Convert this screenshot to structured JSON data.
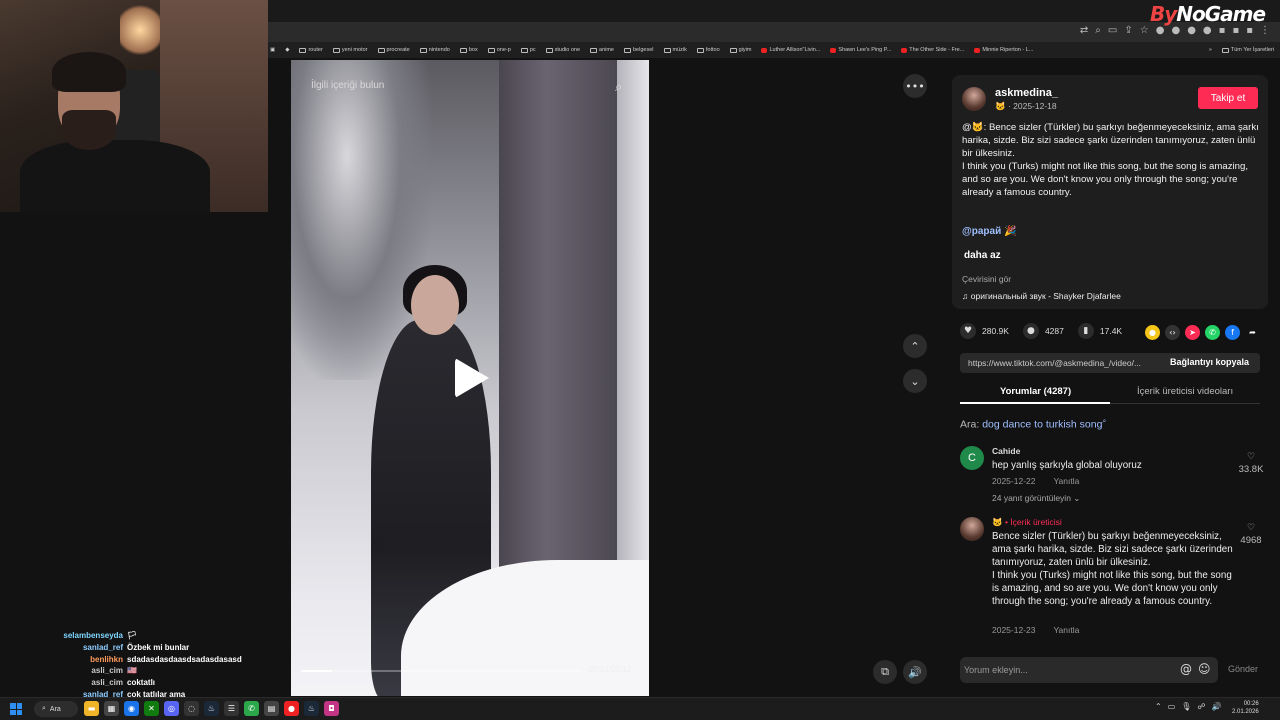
{
  "overlay": {
    "logo_prefix": "By",
    "logo_rest": "NoGame"
  },
  "chat": [
    {
      "user": "selambenseyda",
      "msg": "🏳",
      "user_color": "#7fd6ff"
    },
    {
      "user": "sanlad_ref",
      "msg": "Özbek mi bunlar",
      "user_color": "#8ecdff"
    },
    {
      "user": "benlihkn",
      "msg": "sdadasdasdaasdsadasdasasd",
      "user_color": "#ff9a5c"
    },
    {
      "user": "asli_cim",
      "msg": "🇺🇸",
      "user_color": "#c9c9c9"
    },
    {
      "user": "asli_cim",
      "msg": "coktatlı",
      "user_color": "#c9c9c9"
    },
    {
      "user": "sanlad_ref",
      "msg": "çok tatlılar ama",
      "user_color": "#8ecdff"
    }
  ],
  "browser": {
    "bookmarks": [
      {
        "label": "router",
        "type": "folder"
      },
      {
        "label": "yeni motor",
        "type": "folder"
      },
      {
        "label": "procreate",
        "type": "folder"
      },
      {
        "label": "nintendo",
        "type": "folder"
      },
      {
        "label": "box",
        "type": "folder"
      },
      {
        "label": "one-p",
        "type": "folder"
      },
      {
        "label": "pc",
        "type": "folder"
      },
      {
        "label": "studio one",
        "type": "folder"
      },
      {
        "label": "anime",
        "type": "folder"
      },
      {
        "label": "belgesel",
        "type": "folder"
      },
      {
        "label": "müzik",
        "type": "folder"
      },
      {
        "label": "fottoo",
        "type": "folder"
      },
      {
        "label": "giyim",
        "type": "folder"
      },
      {
        "label": "Luther Allison\"Livin...",
        "type": "yt"
      },
      {
        "label": "Shawn Lee's Ping P...",
        "type": "yt"
      },
      {
        "label": "The Other Side - Fre...",
        "type": "yt"
      },
      {
        "label": "Minnie Riperton - L...",
        "type": "yt"
      }
    ],
    "all_bookmarks": "Tüm Yer İşaretleri"
  },
  "video": {
    "search_label": "İlgili içeriği bulun",
    "time": "00:01/00:12",
    "progress": 0.11
  },
  "post": {
    "author": "askmedina_",
    "date": "· 2025-12-18",
    "follow_label": "Takip et",
    "description_tr": "@🐱: Bence sizler (Türkler) bu şarkıyı beğenmeyeceksiniz, ama şarkı harika, sizde. Biz sizi sadece şarkı üzerinden tanımıyoruz, zaten ünlü bir ülkesiniz.",
    "description_en": "I think you (Turks) might not like this song, but the song is amazing, and so are you. We don't know you only through the song; you're already a famous country.",
    "mention": "@papaй 🎉",
    "less_label": "daha az",
    "see_translation": "Çevirisini gör",
    "music": "♫  оригинальный звук - Shayker Djafarlee",
    "likes": "280.9K",
    "comments": "4287",
    "saves": "17.4K",
    "url": "https://www.tiktok.com/@askmedina_/video/...",
    "copy_link": "Bağlantıyı kopyala",
    "tab_comments": "Yorumlar (4287)",
    "tab_creator": "İçerik üreticisi videoları",
    "search_prefix": "Ara: ",
    "search_term": "dog dance to turkish song"
  },
  "comments": [
    {
      "name": "Cahide",
      "initial": "C",
      "text": "hep yanlış şarkıyla global oluyoruz",
      "date": "2025-12-22",
      "reply": "Yanıtla",
      "likes": "33.8K",
      "more": "24 yanıt görüntüleyin ⌄"
    },
    {
      "name": "🐱 • İçerik üreticisi",
      "text": "Bence sizler (Türkler) bu şarkıyı beğenmeyeceksiniz, ama şarkı harika, sizde. Biz sizi sadece şarkı üzerinden tanımıyoruz, zaten ünlü bir ülkesiniz.\nI think you (Turks) might not like this song, but the song is amazing, and so are you. We don't know you only through the song; you're already a famous country.",
      "date": "2025-12-23",
      "reply": "Yanıtla",
      "likes": "4968"
    }
  ],
  "comment_input": {
    "placeholder": "Yorum ekleyin...",
    "send": "Gönder"
  },
  "taskbar": {
    "search": "Ara",
    "time": "00:26",
    "date": "2.01.2026"
  },
  "colors": {
    "accent": "#fe2c55",
    "link": "#9fbfff"
  }
}
